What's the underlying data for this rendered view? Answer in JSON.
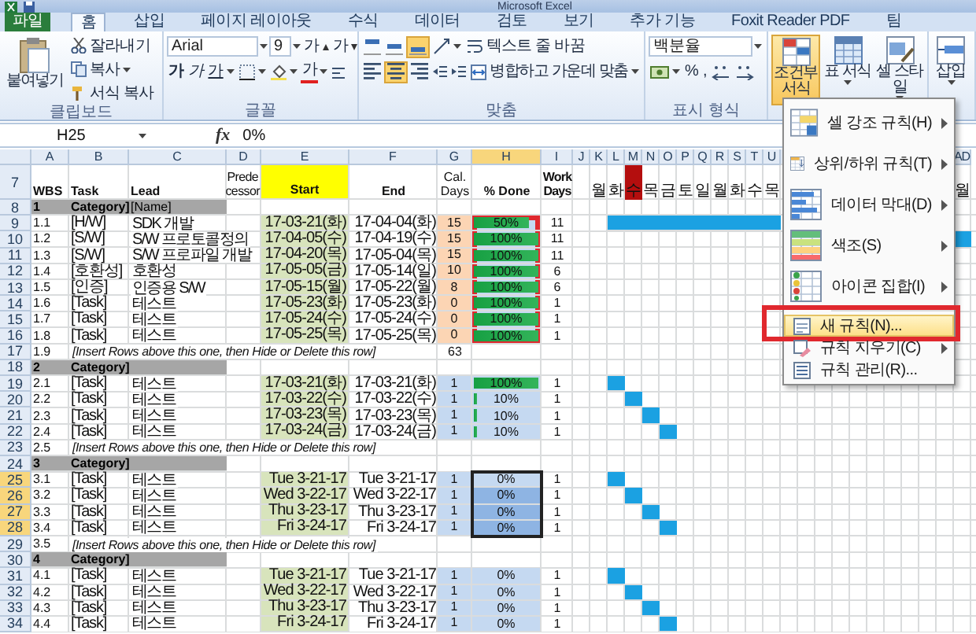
{
  "window": {
    "title": "Microsoft Excel"
  },
  "ribbon_tabs": [
    {
      "label": "파일",
      "kind": "file",
      "selected": false
    },
    {
      "label": "홈",
      "kind": "tab",
      "selected": true
    },
    {
      "label": "삽입",
      "kind": "tab",
      "selected": false
    },
    {
      "label": "페이지 레이아웃",
      "kind": "tab",
      "selected": false
    },
    {
      "label": "수식",
      "kind": "tab",
      "selected": false
    },
    {
      "label": "데이터",
      "kind": "tab",
      "selected": false
    },
    {
      "label": "검토",
      "kind": "tab",
      "selected": false
    },
    {
      "label": "보기",
      "kind": "tab",
      "selected": false
    },
    {
      "label": "추가 기능",
      "kind": "tab",
      "selected": false
    },
    {
      "label": "Foxit Reader PDF",
      "kind": "tab",
      "selected": false
    },
    {
      "label": "팀",
      "kind": "tab",
      "selected": false
    }
  ],
  "ribbon": {
    "clipboard": {
      "label": "클립보드",
      "paste": "붙여넣기",
      "cut": "잘라내기",
      "copy": "복사",
      "painter": "서식 복사"
    },
    "font": {
      "label": "글꼴",
      "family": "Arial",
      "size": "9",
      "grow": "가",
      "shrink": "가",
      "bold": "가",
      "italic": "가",
      "underline": "가",
      "font_color_sample": "가"
    },
    "alignment": {
      "label": "맞춤",
      "vertical": [
        {
          "selected": false
        },
        {
          "selected": false
        },
        {
          "selected": true
        }
      ],
      "horizontal": [
        {
          "selected": false
        },
        {
          "selected": true
        },
        {
          "selected": false
        }
      ],
      "wrap": "텍스트 줄 바꿈",
      "merge": "병합하고 가운데 맞춤"
    },
    "number": {
      "label": "표시 형식",
      "format": "백분율",
      "percent": "%",
      "comma": ","
    },
    "styles": [
      {
        "label": "조건부 서식",
        "kind": "conditional",
        "selected": true
      },
      {
        "label": "표 서식",
        "kind": "table",
        "selected": false
      },
      {
        "label": "셀 스타일",
        "kind": "cell",
        "selected": false
      }
    ],
    "cells": {
      "insert": "삽입"
    }
  },
  "formula_bar": {
    "name_box": "H25",
    "function_label": "fx",
    "value": "0%"
  },
  "sheet": {
    "columns": [
      {
        "letter": "A",
        "selected": false
      },
      {
        "letter": "B",
        "selected": false
      },
      {
        "letter": "C",
        "selected": false
      },
      {
        "letter": "D",
        "selected": false
      },
      {
        "letter": "E",
        "selected": false
      },
      {
        "letter": "F",
        "selected": false
      },
      {
        "letter": "G",
        "selected": false
      },
      {
        "letter": "H",
        "selected": true
      },
      {
        "letter": "I",
        "selected": false
      }
    ],
    "timeline": [
      {
        "letter": "J",
        "today": false
      },
      {
        "letter": "K",
        "day": "월",
        "today": false
      },
      {
        "letter": "L",
        "day": "화",
        "today": false
      },
      {
        "letter": "M",
        "day": "수",
        "today": true
      },
      {
        "letter": "N",
        "day": "목",
        "today": false
      },
      {
        "letter": "O",
        "day": "금",
        "today": false
      },
      {
        "letter": "P",
        "day": "토",
        "today": false
      },
      {
        "letter": "Q",
        "day": "일",
        "today": false
      },
      {
        "letter": "R",
        "day": "월",
        "today": false
      },
      {
        "letter": "S",
        "day": "화",
        "today": false
      },
      {
        "letter": "T",
        "day": "수",
        "today": false
      },
      {
        "letter": "U",
        "day": "목",
        "today": false
      }
    ],
    "timeline_right": [
      {
        "letter": "AD",
        "day": "월",
        "today": false
      }
    ],
    "header": {
      "row": "7",
      "wbs": "WBS",
      "task": "Task",
      "lead": "Lead",
      "predecessor": "Prede cessor",
      "start": "Start",
      "end": "End",
      "cal": "Cal. Days",
      "done": "% Done",
      "work": "Work Days"
    },
    "rows": [
      {
        "num": "8",
        "kind": "category",
        "wbs": "1",
        "task": "Category]",
        "lead": "[Name]",
        "selected": false
      },
      {
        "num": "9",
        "kind": "task",
        "wbs": "1.1",
        "task": "[H/W]",
        "lead": "SDK 개발",
        "start": "17-03-21(화)",
        "end": "17-04-04(화)",
        "cal": "15",
        "color": "#fcd5b4",
        "done": "50%",
        "level": 0.85,
        "work": "11",
        "selected": false,
        "outlined": true,
        "gantt": [
          false,
          false,
          true,
          true,
          true,
          true,
          true,
          true,
          true,
          true,
          true,
          true
        ],
        "gantt_right": [
          false
        ]
      },
      {
        "num": "10",
        "kind": "task",
        "wbs": "1.2",
        "task": "[S/W]",
        "lead": "S/W 프로토콜정의",
        "start": "17-04-05(수)",
        "end": "17-04-19(수)",
        "cal": "15",
        "color": "#fcd5b4",
        "done": "100%",
        "level": 1,
        "work": "11",
        "selected": false,
        "outlined": true,
        "gantt": [
          false,
          false,
          false,
          false,
          false,
          false,
          false,
          false,
          false,
          false,
          false,
          false
        ],
        "gantt_right": [
          true
        ]
      },
      {
        "num": "11",
        "kind": "task",
        "wbs": "1.3",
        "task": "[S/W]",
        "lead": "S/W 프로파일 개발",
        "start": "17-04-20(목)",
        "end": "17-05-04(목)",
        "cal": "15",
        "color": "#fcd5b4",
        "done": "100%",
        "level": 1,
        "work": "11",
        "selected": false,
        "outlined": true,
        "gantt": [
          false,
          false,
          false,
          false,
          false,
          false,
          false,
          false,
          false,
          false,
          false,
          false
        ],
        "gantt_right": [
          false
        ]
      },
      {
        "num": "12",
        "kind": "task",
        "wbs": "1.4",
        "task": "[호환성]",
        "lead": "호환성",
        "start": "17-05-05(금)",
        "end": "17-05-14(일)",
        "cal": "10",
        "color": "#fcd5b4",
        "done": "100%",
        "level": 1,
        "work": "6",
        "selected": false,
        "outlined": true,
        "gantt": [
          false,
          false,
          false,
          false,
          false,
          false,
          false,
          false,
          false,
          false,
          false,
          false
        ],
        "gantt_right": [
          false
        ]
      },
      {
        "num": "13",
        "kind": "task",
        "wbs": "1.5",
        "task": "[인증]",
        "lead": "인증용 S/W",
        "start": "17-05-15(월)",
        "end": "17-05-22(월)",
        "cal": "8",
        "color": "#fcd5b4",
        "done": "100%",
        "level": 1,
        "work": "6",
        "selected": false,
        "outlined": true,
        "gantt": [
          false,
          false,
          false,
          false,
          false,
          false,
          false,
          false,
          false,
          false,
          false,
          false
        ],
        "gantt_right": [
          false
        ]
      },
      {
        "num": "14",
        "kind": "task",
        "wbs": "1.6",
        "task": "[Task]",
        "lead": "테스트",
        "start": "17-05-23(화)",
        "end": "17-05-23(화)",
        "cal": "0",
        "color": "#fcd5b4",
        "done": "100%",
        "level": 1,
        "work": "1",
        "selected": false,
        "outlined": true,
        "gantt": [
          false,
          false,
          false,
          false,
          false,
          false,
          false,
          false,
          false,
          false,
          false,
          false
        ],
        "gantt_right": [
          false
        ]
      },
      {
        "num": "15",
        "kind": "task",
        "wbs": "1.7",
        "task": "[Task]",
        "lead": "테스트",
        "start": "17-05-24(수)",
        "end": "17-05-24(수)",
        "cal": "0",
        "color": "#fcd5b4",
        "done": "100%",
        "level": 1,
        "work": "1",
        "selected": false,
        "outlined": true,
        "gantt": [
          false,
          false,
          false,
          false,
          false,
          false,
          false,
          false,
          false,
          false,
          false,
          false
        ],
        "gantt_right": [
          false
        ]
      },
      {
        "num": "16",
        "kind": "task",
        "wbs": "1.8",
        "task": "[Task]",
        "lead": "테스트",
        "start": "17-05-25(목)",
        "end": "17-05-25(목)",
        "cal": "0",
        "color": "#fcd5b4",
        "done": "100%",
        "level": 1,
        "work": "1",
        "selected": false,
        "outlined": true,
        "gantt": [
          false,
          false,
          false,
          false,
          false,
          false,
          false,
          false,
          false,
          false,
          false,
          false
        ],
        "gantt_right": [
          false
        ]
      },
      {
        "num": "17",
        "kind": "note",
        "wbs": "1.9",
        "note": "[Insert Rows above this one, then Hide or Delete this row]",
        "cal": "63",
        "selected": false
      },
      {
        "num": "18",
        "kind": "category",
        "wbs": "2",
        "task": "Category]",
        "selected": false
      },
      {
        "num": "19",
        "kind": "task",
        "wbs": "2.1",
        "task": "[Task]",
        "lead": "테스트",
        "start": "17-03-21(화)",
        "end": "17-03-21(화)",
        "cal": "1",
        "color": "#c5d9f1",
        "done": "100%",
        "level": 1,
        "work": "1",
        "selected": false,
        "outlined": false,
        "gantt": [
          false,
          false,
          true,
          false,
          false,
          false,
          false,
          false,
          false,
          false,
          false,
          false
        ],
        "gantt_right": [
          false
        ]
      },
      {
        "num": "20",
        "kind": "task",
        "wbs": "2.2",
        "task": "[Task]",
        "lead": "테스트",
        "start": "17-03-22(수)",
        "end": "17-03-22(수)",
        "cal": "1",
        "color": "#c5d9f1",
        "done": "10%",
        "level": 0.1,
        "work": "1",
        "selected": false,
        "outlined": false,
        "gantt": [
          false,
          false,
          false,
          true,
          false,
          false,
          false,
          false,
          false,
          false,
          false,
          false
        ],
        "gantt_right": [
          false
        ]
      },
      {
        "num": "21",
        "kind": "task",
        "wbs": "2.3",
        "task": "[Task]",
        "lead": "테스트",
        "start": "17-03-23(목)",
        "end": "17-03-23(목)",
        "cal": "1",
        "color": "#c5d9f1",
        "done": "10%",
        "level": 0.1,
        "work": "1",
        "selected": false,
        "outlined": false,
        "gantt": [
          false,
          false,
          false,
          false,
          true,
          false,
          false,
          false,
          false,
          false,
          false,
          false
        ],
        "gantt_right": [
          false
        ]
      },
      {
        "num": "22",
        "kind": "task",
        "wbs": "2.4",
        "task": "[Task]",
        "lead": "테스트",
        "start": "17-03-24(금)",
        "end": "17-03-24(금)",
        "cal": "1",
        "color": "#c5d9f1",
        "done": "10%",
        "level": 0.1,
        "work": "1",
        "selected": false,
        "outlined": false,
        "gantt": [
          false,
          false,
          false,
          false,
          false,
          true,
          false,
          false,
          false,
          false,
          false,
          false
        ],
        "gantt_right": [
          false
        ]
      },
      {
        "num": "23",
        "kind": "note",
        "wbs": "2.5",
        "note": "[Insert Rows above this one, then Hide or Delete this row]",
        "selected": false
      },
      {
        "num": "24",
        "kind": "category",
        "wbs": "3",
        "task": "Category]",
        "selected": false
      },
      {
        "num": "25",
        "kind": "task",
        "wbs": "3.1",
        "task": "[Task]",
        "lead": "테스트",
        "start": "Tue 3-21-17",
        "end": "Tue 3-21-17",
        "cal": "1",
        "color": "#c5d9f1",
        "done": "0%",
        "level": 0,
        "work": "1",
        "selected": true,
        "outlined": false,
        "gantt": [
          false,
          false,
          true,
          false,
          false,
          false,
          false,
          false,
          false,
          false,
          false,
          false
        ],
        "gantt_right": [
          false
        ]
      },
      {
        "num": "26",
        "kind": "task",
        "wbs": "3.2",
        "task": "[Task]",
        "lead": "테스트",
        "start": "Wed 3-22-17",
        "end": "Wed 3-22-17",
        "cal": "1",
        "color": "#c5d9f1",
        "done": "0%",
        "level": 0,
        "work": "1",
        "selected": true,
        "outlined": false,
        "gantt": [
          false,
          false,
          false,
          true,
          false,
          false,
          false,
          false,
          false,
          false,
          false,
          false
        ],
        "gantt_right": [
          false
        ]
      },
      {
        "num": "27",
        "kind": "task",
        "wbs": "3.3",
        "task": "[Task]",
        "lead": "테스트",
        "start": "Thu 3-23-17",
        "end": "Thu 3-23-17",
        "cal": "1",
        "color": "#c5d9f1",
        "done": "0%",
        "level": 0,
        "work": "1",
        "selected": true,
        "outlined": false,
        "gantt": [
          false,
          false,
          false,
          false,
          true,
          false,
          false,
          false,
          false,
          false,
          false,
          false
        ],
        "gantt_right": [
          false
        ]
      },
      {
        "num": "28",
        "kind": "task",
        "wbs": "3.4",
        "task": "[Task]",
        "lead": "테스트",
        "start": "Fri 3-24-17",
        "end": "Fri 3-24-17",
        "cal": "1",
        "color": "#c5d9f1",
        "done": "0%",
        "level": 0,
        "work": "1",
        "selected": true,
        "outlined": false,
        "gantt": [
          false,
          false,
          false,
          false,
          false,
          true,
          false,
          false,
          false,
          false,
          false,
          false
        ],
        "gantt_right": [
          false
        ]
      },
      {
        "num": "29",
        "kind": "note",
        "wbs": "3.5",
        "note": "[Insert Rows above this one, then Hide or Delete this row]",
        "selected": false
      },
      {
        "num": "30",
        "kind": "category",
        "wbs": "4",
        "task": "Category]",
        "selected": false
      },
      {
        "num": "31",
        "kind": "task",
        "wbs": "4.1",
        "task": "[Task]",
        "lead": "테스트",
        "start": "Tue 3-21-17",
        "end": "Tue 3-21-17",
        "cal": "1",
        "color": "#c5d9f1",
        "done": "0%",
        "level": 0,
        "work": "1",
        "selected": false,
        "outlined": false,
        "gantt": [
          false,
          false,
          true,
          false,
          false,
          false,
          false,
          false,
          false,
          false,
          false,
          false
        ],
        "gantt_right": [
          false
        ]
      },
      {
        "num": "32",
        "kind": "task",
        "wbs": "4.2",
        "task": "[Task]",
        "lead": "테스트",
        "start": "Wed 3-22-17",
        "end": "Wed 3-22-17",
        "cal": "1",
        "color": "#c5d9f1",
        "done": "0%",
        "level": 0,
        "work": "1",
        "selected": false,
        "outlined": false,
        "gantt": [
          false,
          false,
          false,
          true,
          false,
          false,
          false,
          false,
          false,
          false,
          false,
          false
        ],
        "gantt_right": [
          false
        ]
      },
      {
        "num": "33",
        "kind": "task",
        "wbs": "4.3",
        "task": "[Task]",
        "lead": "테스트",
        "start": "Thu 3-23-17",
        "end": "Thu 3-23-17",
        "cal": "1",
        "color": "#c5d9f1",
        "done": "0%",
        "level": 0,
        "work": "1",
        "selected": false,
        "outlined": false,
        "gantt": [
          false,
          false,
          false,
          false,
          true,
          false,
          false,
          false,
          false,
          false,
          false,
          false
        ],
        "gantt_right": [
          false
        ]
      },
      {
        "num": "34",
        "kind": "task",
        "wbs": "4.4",
        "task": "[Task]",
        "lead": "테스트",
        "start": "Fri 3-24-17",
        "end": "Fri 3-24-17",
        "cal": "1",
        "color": "#c5d9f1",
        "done": "0%",
        "level": 0,
        "work": "1",
        "selected": false,
        "outlined": false,
        "gantt": [
          false,
          false,
          false,
          false,
          false,
          true,
          false,
          false,
          false,
          false,
          false,
          false
        ],
        "gantt_right": [
          false
        ]
      }
    ]
  },
  "menu": {
    "rule_types": [
      {
        "label": "셀 강조 규칙(H)",
        "kind": "highlight",
        "submenu": true,
        "highlighted": false,
        "outlined": false
      },
      {
        "label": "상위/하위 규칙(T)",
        "kind": "topbottom",
        "submenu": true,
        "highlighted": false,
        "outlined": false
      },
      {
        "label": "데이터 막대(D)",
        "kind": "databar",
        "submenu": true,
        "highlighted": false,
        "outlined": false
      },
      {
        "label": "색조(S)",
        "kind": "colorscale",
        "submenu": true,
        "highlighted": false,
        "outlined": false
      },
      {
        "label": "아이콘 집합(I)",
        "kind": "iconset",
        "submenu": true,
        "highlighted": false,
        "outlined": false
      }
    ],
    "actions": [
      {
        "label": "새 규칙(N)...",
        "kind": "new",
        "submenu": false,
        "highlighted": true,
        "outlined": true
      },
      {
        "label": "규칙 지우기(C)",
        "kind": "clear",
        "submenu": true,
        "highlighted": false,
        "outlined": false
      },
      {
        "label": "규칙 관리(R)...",
        "kind": "manage",
        "submenu": false,
        "highlighted": false,
        "outlined": false
      }
    ]
  }
}
